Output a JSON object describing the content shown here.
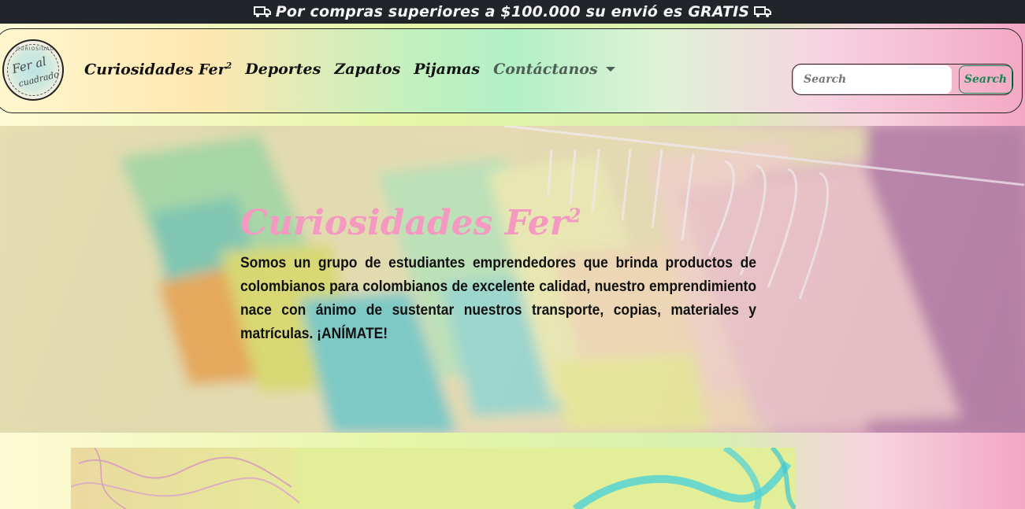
{
  "announcement": {
    "text": "Por compras superiores a $100.000 su envió es GRATIS",
    "icon_left": "truck-icon",
    "icon_right": "truck-icon"
  },
  "navbar": {
    "logo_alt": "Fer al cuadrado",
    "logo_lines": [
      "CURIOSIDADES",
      "Fer al",
      "cuadrado"
    ],
    "links": [
      {
        "label": "Curiosidades Fer",
        "sup": "2"
      },
      {
        "label": "Deportes"
      },
      {
        "label": "Zapatos"
      },
      {
        "label": "Pijamas"
      },
      {
        "label": "Contáctanos",
        "dropdown": true
      }
    ],
    "search": {
      "placeholder": "Search",
      "button_label": "Search"
    }
  },
  "hero": {
    "title": "Curiosidades Fer",
    "title_sup": "2",
    "text": "Somos un grupo de estudiantes emprendedores que brinda productos de colombianos para colombianos de excelente calidad, nuestro emprendimiento nace con ánimo de sustentar nuestros transporte, copias, materiales y matrículas. ¡ANÍMATE!"
  },
  "colors": {
    "topbar": "#212529",
    "hero_title": "#f49ac1",
    "search_button": "#198754"
  }
}
